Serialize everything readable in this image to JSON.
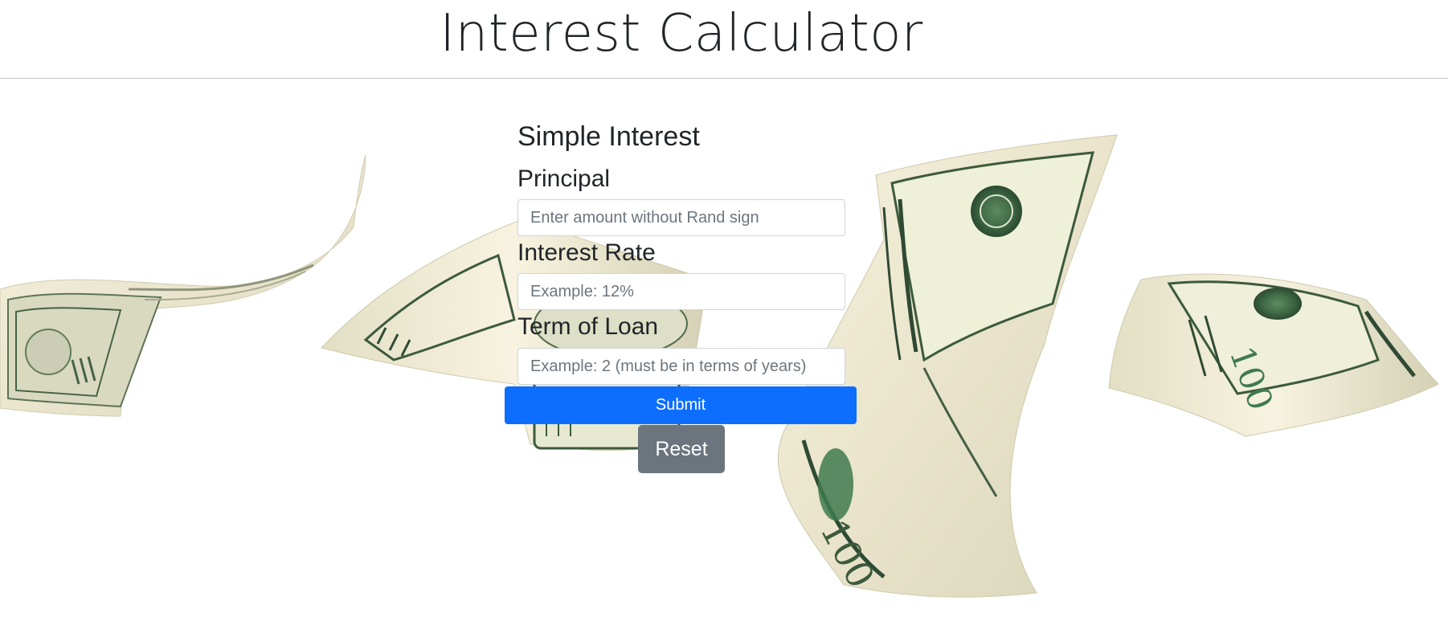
{
  "header": {
    "title": "Interest Calculator"
  },
  "form": {
    "section_title": "Simple Interest",
    "principal": {
      "label": "Principal",
      "placeholder": "Enter amount without Rand sign",
      "value": ""
    },
    "interest_rate": {
      "label": "Interest Rate",
      "placeholder": "Example: 12%",
      "value": ""
    },
    "term": {
      "label": "Term of Loan",
      "placeholder": "Example: 2 (must be in terms of years)",
      "value": ""
    },
    "submit_label": "Submit",
    "reset_label": "Reset"
  },
  "background": {
    "image": "floating-hundred-dollar-bills",
    "banknote_text": "100"
  },
  "colors": {
    "primary": "#0d6efd",
    "secondary": "#6c757d",
    "text": "#212529",
    "background": "#ffffff",
    "banknote_paper": "#efe9d2",
    "banknote_ink": "#3c5a3c"
  }
}
